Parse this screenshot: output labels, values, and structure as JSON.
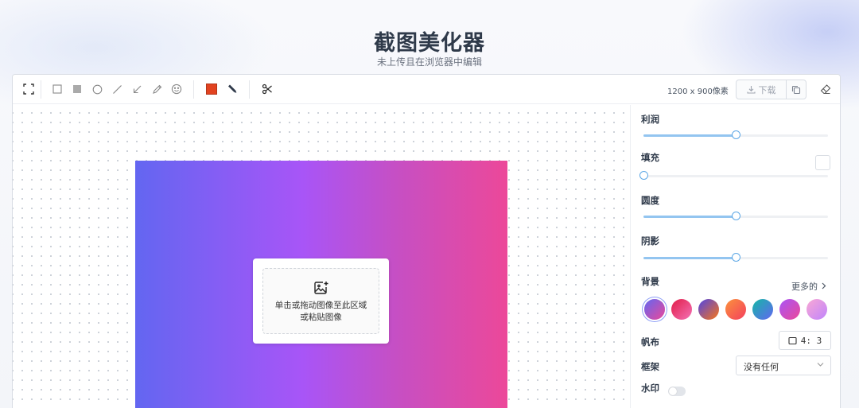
{
  "header": {
    "title": "截图美化器",
    "subtitle": "未上传且在浏览器中编辑"
  },
  "toolbar": {
    "tools": [
      {
        "name": "crop-frame-icon"
      },
      {
        "name": "rectangle-outline-icon"
      },
      {
        "name": "rectangle-filled-icon"
      },
      {
        "name": "circle-icon"
      },
      {
        "name": "line-icon"
      },
      {
        "name": "arrow-icon"
      },
      {
        "name": "pencil-icon"
      },
      {
        "name": "emoji-icon"
      },
      {
        "name": "color-picker",
        "color": "#e24320"
      },
      {
        "name": "marker-icon"
      },
      {
        "name": "scissors-icon"
      }
    ],
    "size_readout": "1200 x 900像素",
    "download_label": "下载",
    "copy_icon": "copy-icon",
    "eraser_icon": "eraser-icon"
  },
  "upload": {
    "line1": "单击或拖动图像至此区域",
    "line2": "或粘贴图像"
  },
  "panel": {
    "padding_label": "利润",
    "padding_value": 0.5,
    "fill_label": "填充",
    "fill_value": 0.0,
    "radius_label": "圆度",
    "radius_value": 0.5,
    "shadow_label": "阴影",
    "shadow_value": 0.5,
    "background_label": "背景",
    "more_label": "更多的",
    "backgrounds": [
      {
        "from": "#6366f1",
        "to": "#ec4899",
        "selected": true
      },
      {
        "from": "#e11d48",
        "to": "#f472b6"
      },
      {
        "from": "#4f46e5",
        "to": "#f97316"
      },
      {
        "from": "#fb923c",
        "to": "#f43f5e"
      },
      {
        "from": "#14b8a6",
        "to": "#6366f1"
      },
      {
        "from": "#a855f7",
        "to": "#ec4899"
      },
      {
        "from": "#f9a8d4",
        "to": "#c084fc"
      }
    ],
    "canvas_label": "帆布",
    "canvas_ratio": "4: 3",
    "frame_label": "框架",
    "frame_value": "没有任何",
    "watermark_label": "水印",
    "watermark_on": false
  }
}
